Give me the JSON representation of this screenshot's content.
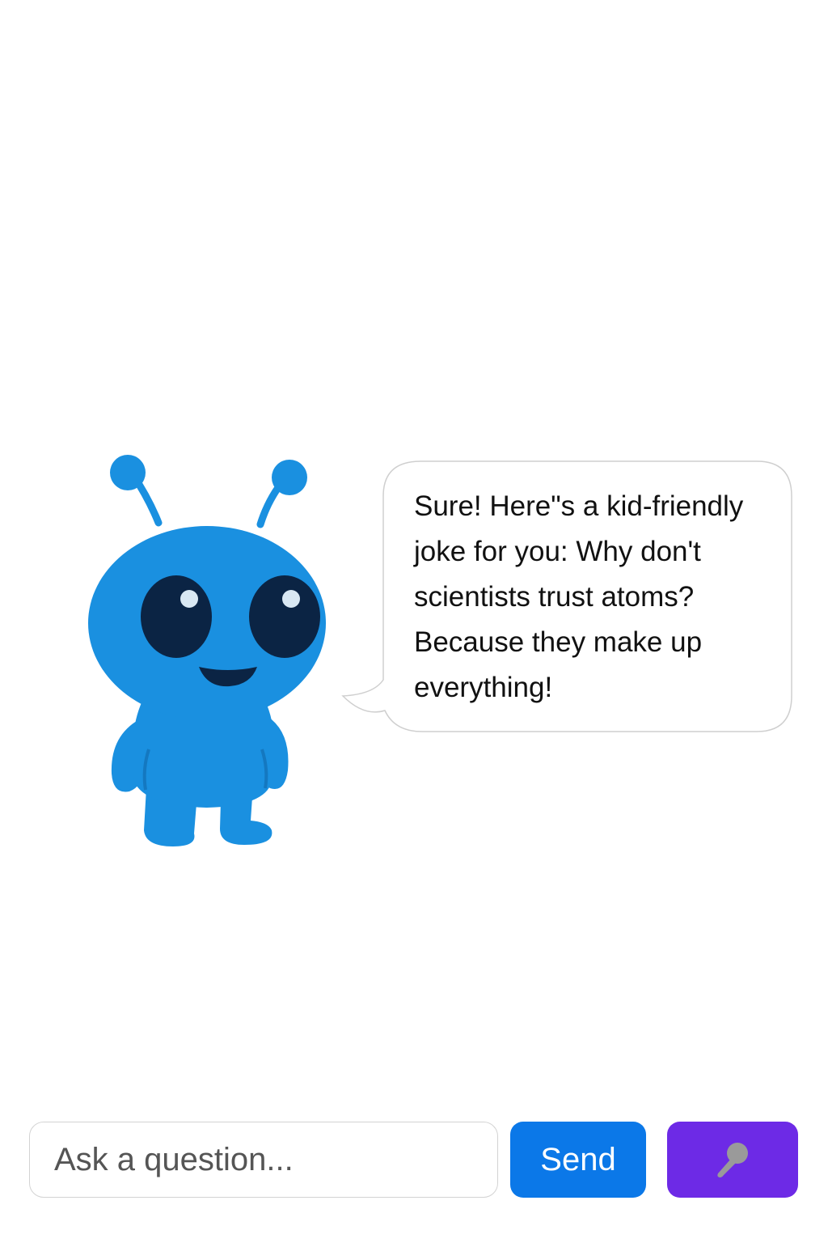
{
  "chat": {
    "reply": "Sure! Here\"s a kid-friendly joke for you: Why don't scientists trust atoms? Because they make up everything!"
  },
  "composer": {
    "placeholder": "Ask a question...",
    "send_label": "Send",
    "mic_icon": "microphone-icon"
  },
  "colors": {
    "mascot_blue": "#1a90e0",
    "send_blue": "#0b78e8",
    "mic_purple": "#6d2ae6"
  }
}
